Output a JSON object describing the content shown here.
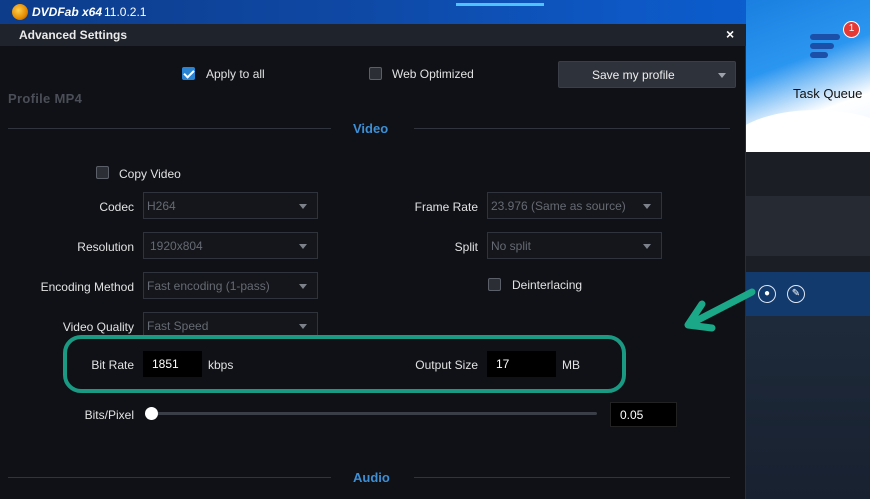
{
  "app": {
    "brand": "DVDFab x64",
    "version": "11.0.2.1",
    "task_queue_label": "Task Queue",
    "task_queue_badge": "1"
  },
  "dialog": {
    "title": "Advanced Settings",
    "close_glyph": "×",
    "profile_label": "Profile  MP4",
    "apply_to_all": {
      "label": "Apply to all",
      "checked": true
    },
    "web_optimized": {
      "label": "Web Optimized",
      "checked": false
    },
    "save_profile": {
      "label": "Save my profile"
    }
  },
  "video": {
    "section_title": "Video",
    "copy_video": {
      "label": "Copy Video",
      "checked": false
    },
    "codec": {
      "label": "Codec",
      "value": "H264"
    },
    "resolution": {
      "label": "Resolution",
      "value": "1920x804"
    },
    "encoding_method": {
      "label": "Encoding Method",
      "value": "Fast encoding (1-pass)"
    },
    "video_quality": {
      "label": "Video Quality",
      "value": "Fast Speed"
    },
    "frame_rate": {
      "label": "Frame Rate",
      "value": "23.976 (Same as source)"
    },
    "split": {
      "label": "Split",
      "value": "No split"
    },
    "deinterlacing": {
      "label": "Deinterlacing",
      "checked": false
    },
    "bit_rate": {
      "label": "Bit Rate",
      "value": "1851",
      "unit": "kbps"
    },
    "output_size": {
      "label": "Output Size",
      "value": "17",
      "unit": "MB"
    },
    "bits_pixel": {
      "label": "Bits/Pixel",
      "value": "0.05",
      "slider_fraction": 0.0
    }
  },
  "audio": {
    "section_title": "Audio"
  },
  "colors": {
    "accent": "#3d8fd6",
    "highlight_border": "#1a9a82",
    "checkbox_checked": "#2a84d2",
    "badge": "#e53935"
  },
  "icons": [
    "task-queue-icon",
    "convert-icon",
    "edit-icon",
    "annotation-arrow"
  ]
}
